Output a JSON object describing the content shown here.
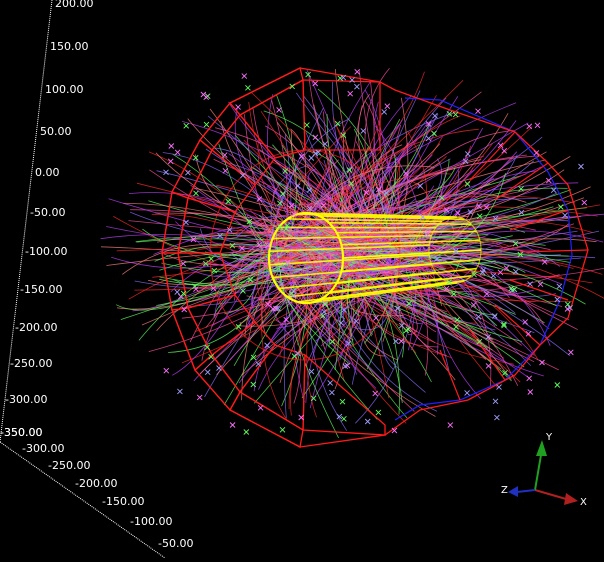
{
  "axis_vertical": {
    "ticks": [
      "200.00",
      "150.00",
      "100.00",
      "50.00",
      "0.00",
      "-50.00",
      "-100.00",
      "-150.00",
      "-200.00",
      "-250.00",
      "-300.00",
      "-350.00"
    ]
  },
  "axis_depth": {
    "ticks": [
      "-350.00",
      "-300.00",
      "-250.00",
      "-200.00",
      "-150.00",
      "-100.00",
      "-50.00"
    ]
  },
  "orientation_gizmo": {
    "x_label": "X",
    "y_label": "Y",
    "z_label": "Z",
    "x_color": "#b02020",
    "y_color": "#20a020",
    "z_color": "#2030c0"
  },
  "colors": {
    "background": "#000000",
    "calorimeter": "#ff1a1a",
    "endcap": "#2020ff",
    "inner_tracker": "#ffff00",
    "tracks": [
      "#ff2a2a",
      "#c040ff",
      "#8a6cff",
      "#ff50a0",
      "#60ff60",
      "#ff8080"
    ],
    "hits": [
      "#ff70ff",
      "#60ff60",
      "#a0a0ff"
    ]
  }
}
